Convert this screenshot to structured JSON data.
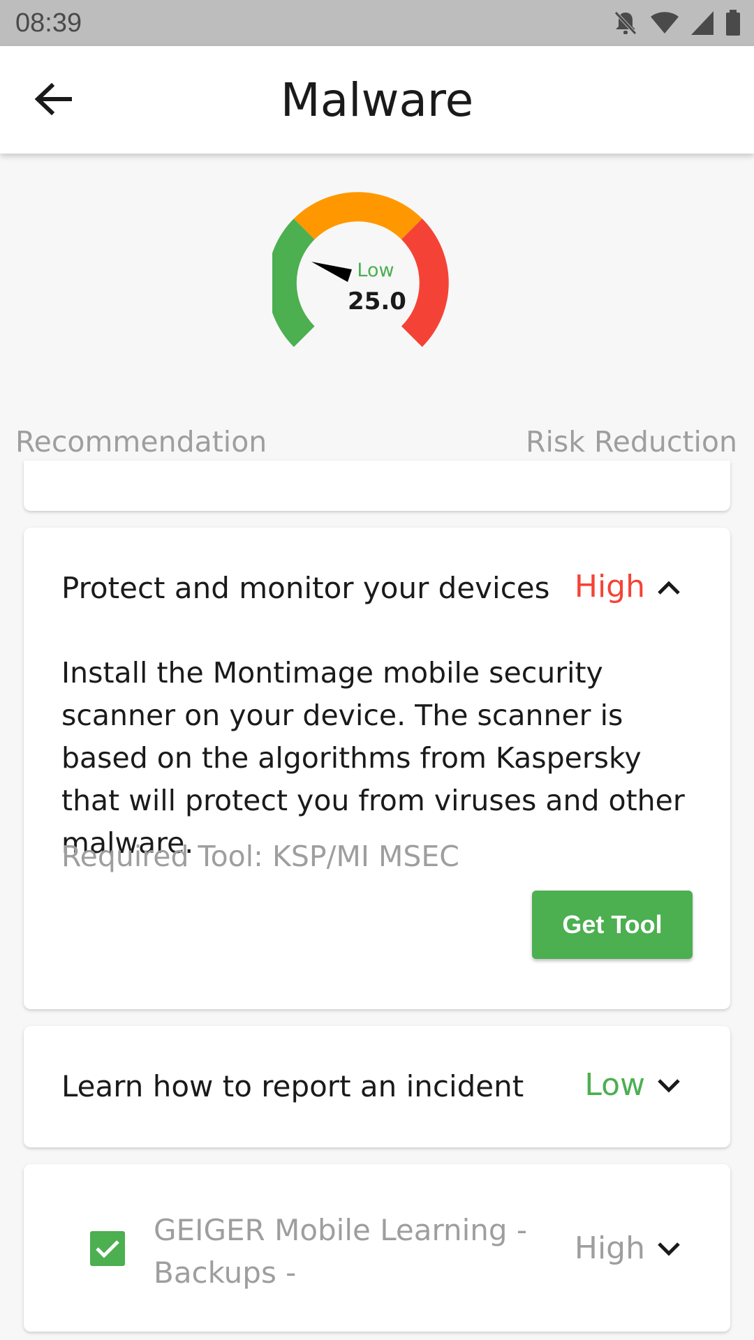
{
  "status_bar": {
    "time": "08:39",
    "icons": [
      "notifications-off-icon",
      "wifi-icon",
      "signal-icon",
      "battery-icon"
    ]
  },
  "app_bar": {
    "title": "Malware",
    "back_icon": "arrow-back-icon"
  },
  "gauge": {
    "label": "Low",
    "value": "25.0",
    "colors": {
      "low": "#4caf50",
      "medium": "#ff9800",
      "high": "#f44336"
    }
  },
  "columns": {
    "left": "Recommendation",
    "right": "Risk Reduction"
  },
  "recommendations": [
    {
      "title": "Protect and monitor your devices",
      "level": "High",
      "level_color": "#f44336",
      "expanded": true,
      "chevron_icon": "chevron-up-icon",
      "description": "Install the Montimage mobile security scanner on your device. The scanner is based on the algorithms from Kaspersky that will protect you from viruses and other malware.",
      "required_tool": "Required Tool: KSP/MI MSEC",
      "button_label": "Get Tool"
    },
    {
      "title": "Learn how to report an incident",
      "level": "Low",
      "level_color": "#4caf50",
      "expanded": false,
      "chevron_icon": "chevron-down-icon"
    },
    {
      "title": "GEIGER Mobile Learning - Backups -",
      "level": "High",
      "level_color": "#9e9e9e",
      "checked": true,
      "expanded": false,
      "chevron_icon": "chevron-down-icon"
    }
  ]
}
